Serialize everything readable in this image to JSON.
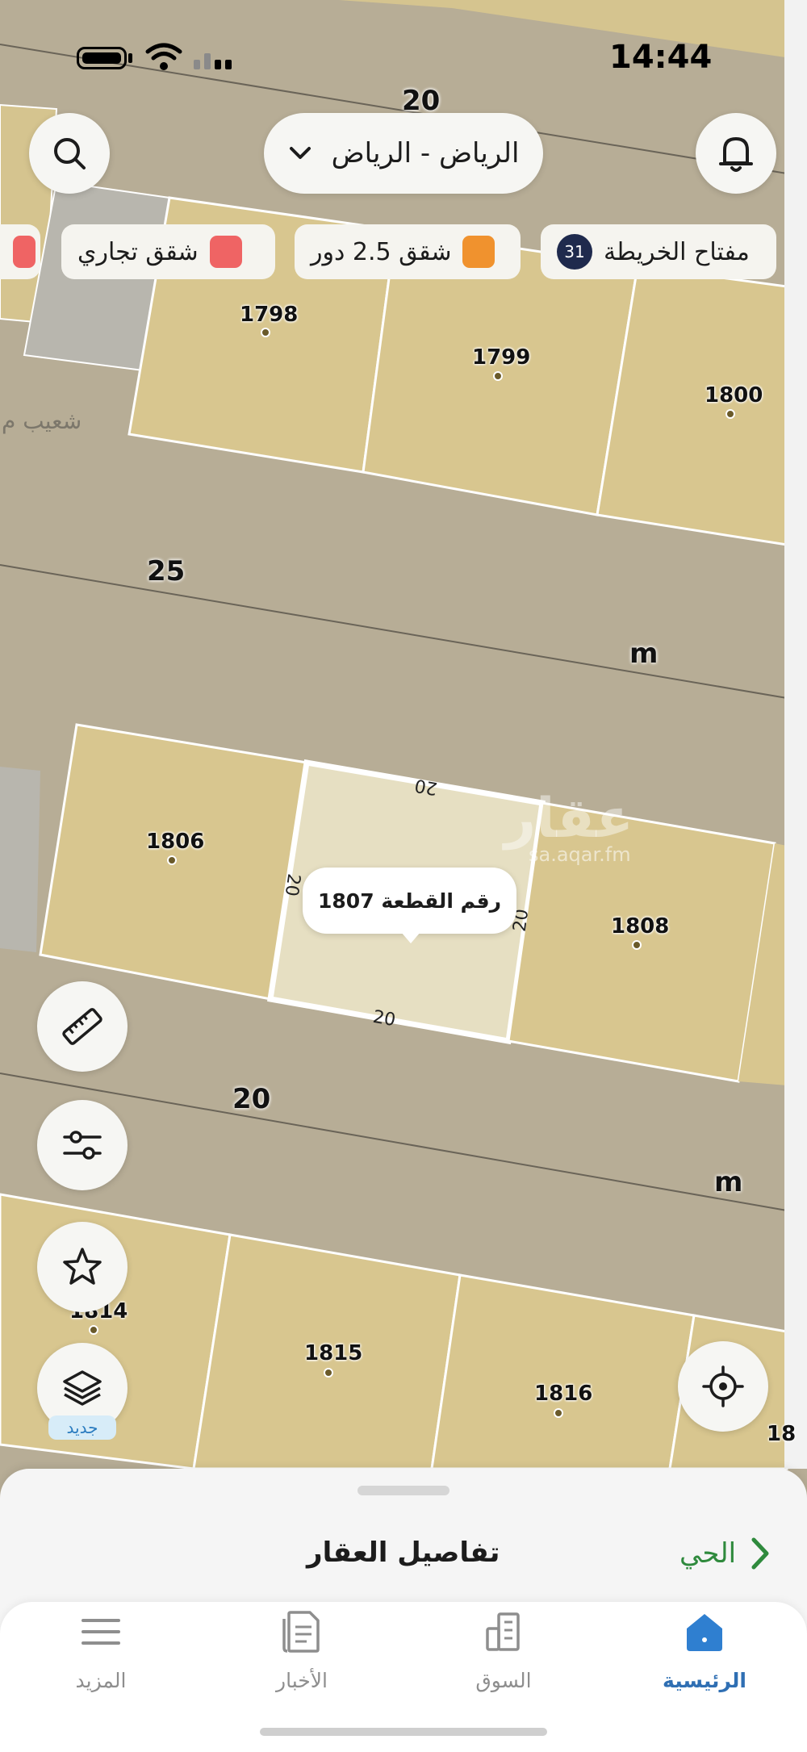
{
  "status_bar": {
    "time": "14:44"
  },
  "header": {
    "city": "الرياض - الرياض"
  },
  "legend": {
    "key_label": "مفتاح الخريطة",
    "key_count": "31",
    "chips": [
      {
        "label": "شقق 2.5 دور",
        "color": "#f0922e"
      },
      {
        "label": "شقق تجاري",
        "color": "#ef6464"
      }
    ]
  },
  "map": {
    "plots": [
      {
        "number": "1798"
      },
      {
        "number": "1799"
      },
      {
        "number": "1800"
      },
      {
        "number": "1806"
      },
      {
        "number": "1808"
      },
      {
        "number": "1814"
      },
      {
        "number": "1815"
      },
      {
        "number": "1816"
      },
      {
        "number": "18"
      }
    ],
    "street_widths": [
      "20",
      "25",
      "m",
      "20",
      "m"
    ],
    "street_name": "شعيب م",
    "selected_plot": {
      "label": "رقم القطعة 1807",
      "dimensions": [
        "20",
        "20",
        "20",
        "20"
      ]
    },
    "watermark": "عقار",
    "watermark_url": "sa.aqar.fm"
  },
  "side_tools": {
    "new_badge": "جديد"
  },
  "sheet": {
    "title": "تفاصيل العقار",
    "district_link": "الحي"
  },
  "tabbar": {
    "items": [
      {
        "label": "الرئيسية"
      },
      {
        "label": "السوق"
      },
      {
        "label": "الأخبار"
      },
      {
        "label": "المزيد"
      }
    ]
  },
  "colors": {
    "parcel_fill": "#d8c68f",
    "road": "#b3aa97",
    "selected_fill": "#e6dfc2",
    "accent_blue": "#2f6fb3",
    "accent_green": "#2f8a3d"
  }
}
